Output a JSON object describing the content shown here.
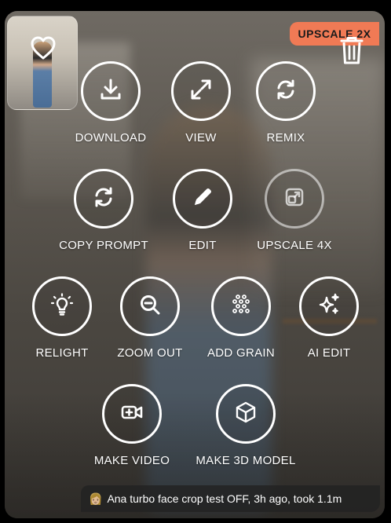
{
  "badge": {
    "label": "UPSCALE 2X"
  },
  "actions": [
    {
      "label": "DOWNLOAD",
      "icon": "download-icon"
    },
    {
      "label": "VIEW",
      "icon": "expand-icon"
    },
    {
      "label": "REMIX",
      "icon": "refresh-icon"
    },
    {
      "label": "COPY PROMPT",
      "icon": "refresh-icon"
    },
    {
      "label": "EDIT",
      "icon": "pencil-icon"
    },
    {
      "label": "UPSCALE 4X",
      "icon": "upscale-icon"
    },
    {
      "label": "RELIGHT",
      "icon": "lightbulb-icon"
    },
    {
      "label": "ZOOM OUT",
      "icon": "zoom-out-icon"
    },
    {
      "label": "ADD GRAIN",
      "icon": "grain-icon"
    },
    {
      "label": "AI EDIT",
      "icon": "sparkle-icon"
    },
    {
      "label": "MAKE VIDEO",
      "icon": "video-icon"
    },
    {
      "label": "MAKE 3D MODEL",
      "icon": "cube-icon"
    }
  ],
  "caption": {
    "emoji": "👩🏼",
    "text": "Ana turbo face crop test OFF, 3h ago, took 1.1m"
  }
}
